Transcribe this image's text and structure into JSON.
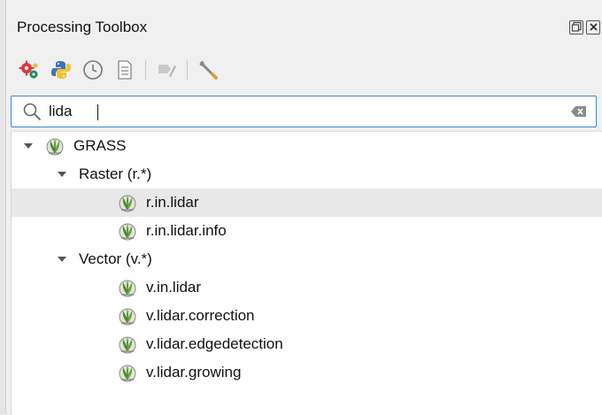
{
  "panel": {
    "title": "Processing Toolbox"
  },
  "toolbar": {
    "tools": [
      {
        "icon": "gears-icon"
      },
      {
        "icon": "python-icon"
      },
      {
        "icon": "history-icon"
      },
      {
        "icon": "results-icon"
      },
      {
        "icon": "edit-features-icon"
      },
      {
        "icon": "options-wrench-icon"
      }
    ]
  },
  "search": {
    "value": "lida"
  },
  "tree": {
    "root": {
      "label": "GRASS",
      "expanded": true
    },
    "groups": [
      {
        "label": "Raster (r.*)",
        "expanded": true,
        "items": [
          "r.in.lidar",
          "r.in.lidar.info"
        ]
      },
      {
        "label": "Vector (v.*)",
        "expanded": true,
        "items": [
          "v.in.lidar",
          "v.lidar.correction",
          "v.lidar.edgedetection",
          "v.lidar.growing"
        ]
      }
    ],
    "selected": "r.in.lidar"
  },
  "colors": {
    "focus_border": "#3a86e0",
    "selection": "#e8e8e8",
    "grass_green": "#5f9a3b"
  }
}
